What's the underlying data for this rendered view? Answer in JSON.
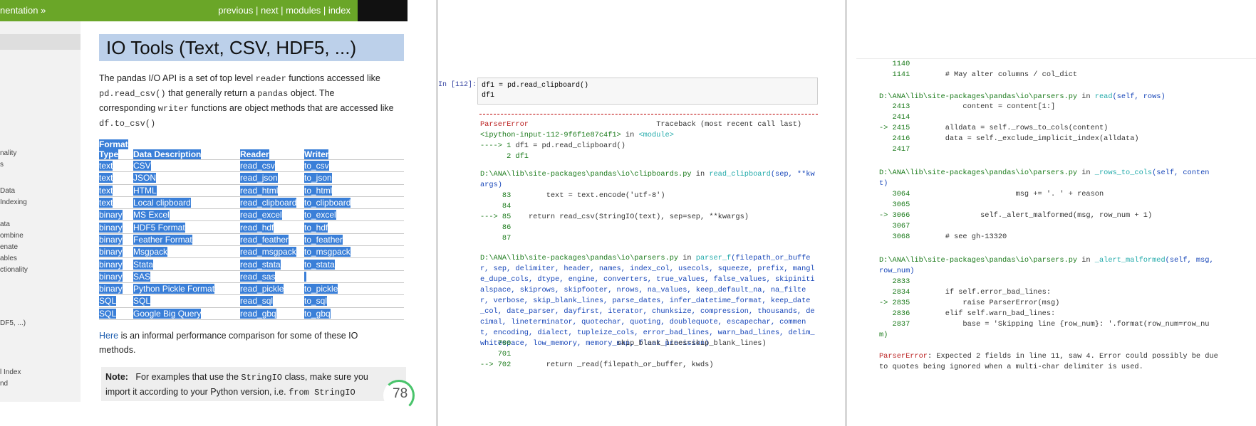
{
  "docs": {
    "crumb": "nentation »",
    "nav": [
      "previous",
      "next",
      "modules",
      "index"
    ],
    "sidebar_items": [
      "nality",
      "s",
      "Data",
      "Indexing",
      "ata",
      "ombine",
      "enate",
      "ables",
      "ctionality",
      "DF5, ...)",
      "l Index",
      "nd"
    ],
    "title": "IO Tools (Text, CSV, HDF5, ...)",
    "intro": {
      "l1a": "The pandas I/O API is a set of top level ",
      "l1code": "reader",
      "l1b": " functions accessed like",
      "l2code1": "pd.read_csv()",
      "l2a": " that generally return a ",
      "l2code2": "pandas",
      "l2b": " object. The",
      "l3a": "corresponding ",
      "l3code": "writer",
      "l3b": " functions are object methods that are accessed like",
      "l4code": "df.to_csv()"
    },
    "table_headers": [
      "Format Type",
      "Data Description",
      "Reader",
      "Writer"
    ],
    "table_rows": [
      [
        "text",
        "CSV",
        "read_csv",
        "to_csv"
      ],
      [
        "text",
        "JSON",
        "read_json",
        "to_json"
      ],
      [
        "text",
        "HTML",
        "read_html",
        "to_html"
      ],
      [
        "text",
        "Local clipboard",
        "read_clipboard",
        "to_clipboard"
      ],
      [
        "binary",
        "MS Excel",
        "read_excel",
        "to_excel"
      ],
      [
        "binary",
        "HDF5 Format",
        "read_hdf",
        "to_hdf"
      ],
      [
        "binary",
        "Feather Format",
        "read_feather",
        "to_feather"
      ],
      [
        "binary",
        "Msgpack",
        "read_msgpack",
        "to_msgpack"
      ],
      [
        "binary",
        "Stata",
        "read_stata",
        "to_stata"
      ],
      [
        "binary",
        "SAS",
        "read_sas",
        ""
      ],
      [
        "binary",
        "Python Pickle Format",
        "read_pickle",
        "to_pickle"
      ],
      [
        "SQL",
        "SQL",
        "read_sql",
        "to_sql"
      ],
      [
        "SQL",
        "Google Big Query",
        "read_gbq",
        "to_gbq"
      ]
    ],
    "after_link": "Here",
    "after_text": " is an informal performance comparison for some of these IO",
    "after_text2": "methods.",
    "note_label": "Note:",
    "note_l1a": "For examples that use the ",
    "note_l1code": "StringIO",
    "note_l1b": " class, make sure you",
    "note_l2a": "import it according to your Python version, i.e. ",
    "note_l2code": "from StringIO",
    "badge_value": "78"
  },
  "notebook": {
    "prompt": "In [112]:",
    "cell_code": [
      "df1 = pd.read_clipboard()",
      "df1"
    ],
    "error_name": "ParserError",
    "traceback_label": "Traceback (most recent call last)",
    "input_ref": "<ipython-input-112-9f6f1e87c4f1>",
    "in_word": " in ",
    "module": "<module>",
    "frame1_arrow": "----> 1 ",
    "frame1_code": "df1 = pd.read_clipboard()",
    "frame1_line2": "      2 df1",
    "path_clip": "D:\\ANA\\lib\\site-packages\\pandas\\io\\clipboards.py",
    "fn_clip": "read_clipboard",
    "sig_clip_a": "(sep, **kw",
    "sig_clip_b": "args)",
    "clip_lines": [
      {
        "no": "     83",
        "code": "        text = text.encode('utf-8')"
      },
      {
        "no": "     84",
        "code": ""
      },
      {
        "no": "---> 85",
        "code": "    return read_csv(StringIO(text), sep=sep, **kwargs)"
      },
      {
        "no": "     86",
        "code": ""
      },
      {
        "no": "     87",
        "code": ""
      }
    ],
    "path_parsers": "D:\\ANA\\lib\\site-packages\\pandas\\io\\parsers.py",
    "fn_parser_f": "parser_f",
    "sig_parser_f": [
      "(filepath_or_buffe",
      "r, sep, delimiter, header, names, index_col, usecols, squeeze, prefix, mangl",
      "e_dupe_cols, dtype, engine, converters, true_values, false_values, skipiniti",
      "alspace, skiprows, skipfooter, nrows, na_values, keep_default_na, na_filte",
      "r, verbose, skip_blank_lines, parse_dates, infer_datetime_format, keep_date",
      "_col, date_parser, dayfirst, iterator, chunksize, compression, thousands, de",
      "cimal, lineterminator, quotechar, quoting, doublequote, escapechar, commen",
      "t, encoding, dialect, tupleize_cols, error_bad_lines, warn_bad_lines, delim_",
      "whitespace, low_memory, memory_map, float_precision)"
    ],
    "parser_lines": [
      {
        "no": "    700",
        "code": "                        skip_blank_lines=skip_blank_lines)"
      },
      {
        "no": "    701",
        "code": ""
      },
      {
        "no": "--> 702",
        "code": "        return _read(filepath_or_buffer, kwds)"
      }
    ]
  },
  "traceback2": {
    "top_lines": [
      {
        "no": "   1140",
        "code": ""
      },
      {
        "no": "   1141",
        "code": "        # May alter columns / col_dict"
      }
    ],
    "path": "D:\\ANA\\lib\\site-packages\\pandas\\io\\parsers.py",
    "in_word": " in ",
    "fn_read": "read",
    "sig_read": "(self, rows)",
    "read_lines": [
      {
        "no": "   2413",
        "code": "            content = content[1:]"
      },
      {
        "no": "   2414",
        "code": ""
      },
      {
        "no": "-> 2415",
        "code": "        alldata = self._rows_to_cols(content)"
      },
      {
        "no": "   2416",
        "code": "        data = self._exclude_implicit_index(alldata)"
      },
      {
        "no": "   2417",
        "code": ""
      }
    ],
    "fn_rtc": "_rows_to_cols",
    "sig_rtc_a": "(self, conten",
    "sig_rtc_b": "t)",
    "rtc_lines": [
      {
        "no": "   3064",
        "code": "                        msg += '. ' + reason"
      },
      {
        "no": "   3065",
        "code": ""
      },
      {
        "no": "-> 3066",
        "code": "                self._alert_malformed(msg, row_num + 1)"
      },
      {
        "no": "   3067",
        "code": ""
      },
      {
        "no": "   3068",
        "code": "        # see gh-13320"
      }
    ],
    "fn_am": "_alert_malformed",
    "sig_am_a": "(self, msg,",
    "sig_am_b": "row_num)",
    "am_lines": [
      {
        "no": "   2833",
        "code": ""
      },
      {
        "no": "   2834",
        "code": "        if self.error_bad_lines:"
      },
      {
        "no": "-> 2835",
        "code": "            raise ParserError(msg)"
      },
      {
        "no": "   2836",
        "code": "        elif self.warn_bad_lines:"
      },
      {
        "no": "   2837",
        "code": "            base = 'Skipping line {row_num}: '.format(row_num=row_nu"
      },
      {
        "no": "m)",
        "code": ""
      }
    ],
    "error_name": "ParserError",
    "error_msg1": ": Expected 2 fields in line 11, saw 4. Error could possibly be due",
    "error_msg2": "to quotes being ignored when a multi-char delimiter is used."
  }
}
